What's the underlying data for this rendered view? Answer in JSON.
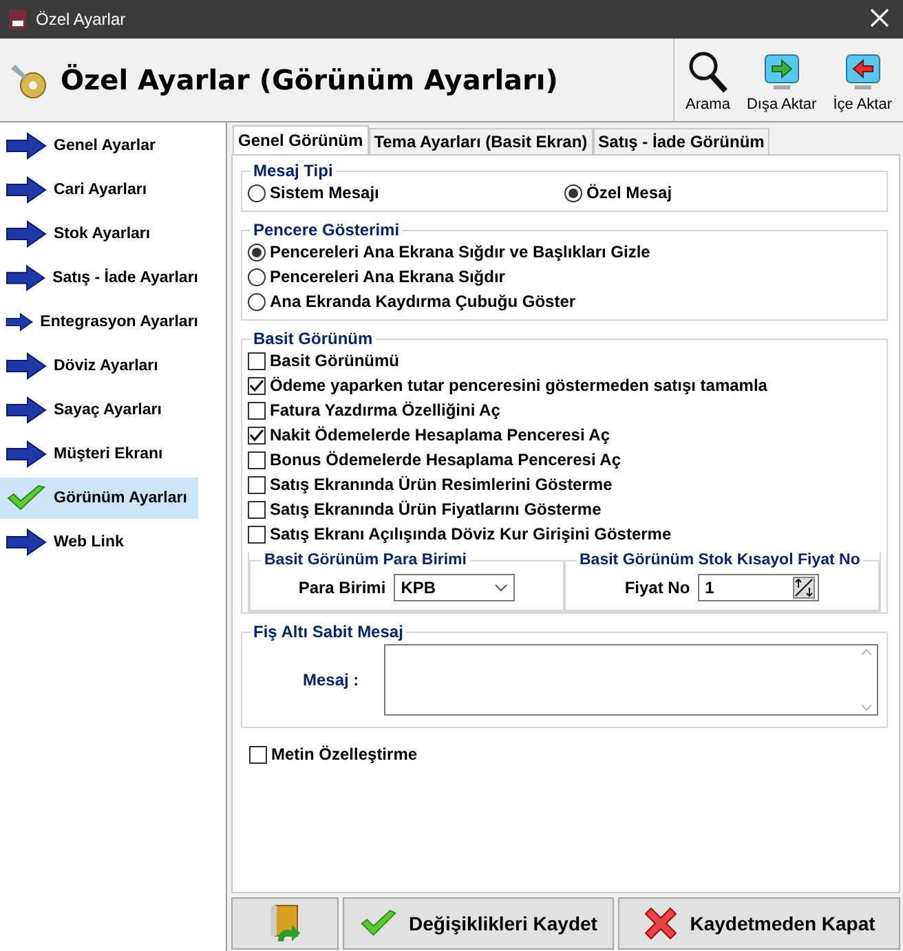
{
  "window": {
    "title": "Özel Ayarlar"
  },
  "header": {
    "title": "Özel Ayarlar (Görünüm Ayarları)",
    "tools": [
      {
        "kind": "search",
        "label": "Arama"
      },
      {
        "kind": "export",
        "label": "Dışa Aktar"
      },
      {
        "kind": "import",
        "label": "İçe Aktar"
      }
    ]
  },
  "sidebar": {
    "items": [
      {
        "label": "Genel Ayarlar",
        "selected": false
      },
      {
        "label": "Cari Ayarları",
        "selected": false
      },
      {
        "label": "Stok Ayarları",
        "selected": false
      },
      {
        "label": "Satış - İade Ayarları",
        "selected": false
      },
      {
        "label": "Entegrasyon Ayarları",
        "selected": false
      },
      {
        "label": "Döviz Ayarları",
        "selected": false
      },
      {
        "label": "Sayaç Ayarları",
        "selected": false
      },
      {
        "label": "Müşteri Ekranı",
        "selected": false
      },
      {
        "label": "Görünüm Ayarları",
        "selected": true
      },
      {
        "label": "Web Link",
        "selected": false
      }
    ]
  },
  "tabs": [
    {
      "label": "Genel Görünüm",
      "selected": true
    },
    {
      "label": "Tema Ayarları (Basit Ekran)",
      "selected": false
    },
    {
      "label": "Satış - İade Görünüm",
      "selected": false
    }
  ],
  "mesaj_tipi": {
    "title": "Mesaj Tipi",
    "options": [
      {
        "label": "Sistem Mesajı",
        "selected": false
      },
      {
        "label": "Özel Mesaj",
        "selected": true
      }
    ]
  },
  "pencere_gosterimi": {
    "title": "Pencere Gösterimi",
    "options": [
      {
        "label": "Pencereleri Ana Ekrana Sığdır ve Başlıkları Gizle",
        "selected": true
      },
      {
        "label": "Pencereleri Ana Ekrana Sığdır",
        "selected": false
      },
      {
        "label": "Ana Ekranda Kaydırma Çubuğu Göster",
        "selected": false
      }
    ]
  },
  "basit_gorunum": {
    "title": "Basit  Görünüm",
    "options": [
      {
        "label": "Basit Görünümü",
        "checked": false
      },
      {
        "label": "Ödeme yaparken tutar penceresini göstermeden satışı tamamla",
        "checked": true
      },
      {
        "label": "Fatura Yazdırma Özelliğini Aç",
        "checked": false
      },
      {
        "label": "Nakit Ödemelerde Hesaplama Penceresi Aç",
        "checked": true
      },
      {
        "label": "Bonus Ödemelerde Hesaplama Penceresi Aç",
        "checked": false
      },
      {
        "label": "Satış Ekranında Ürün Resimlerini Gösterme",
        "checked": false
      },
      {
        "label": "Satış Ekranında Ürün Fiyatlarını Gösterme",
        "checked": false
      },
      {
        "label": "Satış Ekranı Açılışında Döviz Kur Girişini Gösterme",
        "checked": false
      }
    ],
    "para_birimi": {
      "title": "Basit Görünüm Para Birimi",
      "label": "Para Birimi",
      "value": "KPB"
    },
    "fiyat_no": {
      "title": "Basit Görünüm Stok Kısayol Fiyat No",
      "label": "Fiyat No",
      "value": "1"
    }
  },
  "fis_alti": {
    "title": "Fiş Altı Sabit Mesaj",
    "label": "Mesaj :"
  },
  "metin_ozellestirme": {
    "label": "Metin Özelleştirme",
    "checked": false
  },
  "buttons": [
    {
      "kind": "exit"
    },
    {
      "kind": "save",
      "label": "Değişiklikleri Kaydet"
    },
    {
      "kind": "cancel",
      "label": "Kaydetmeden Kapat"
    }
  ]
}
